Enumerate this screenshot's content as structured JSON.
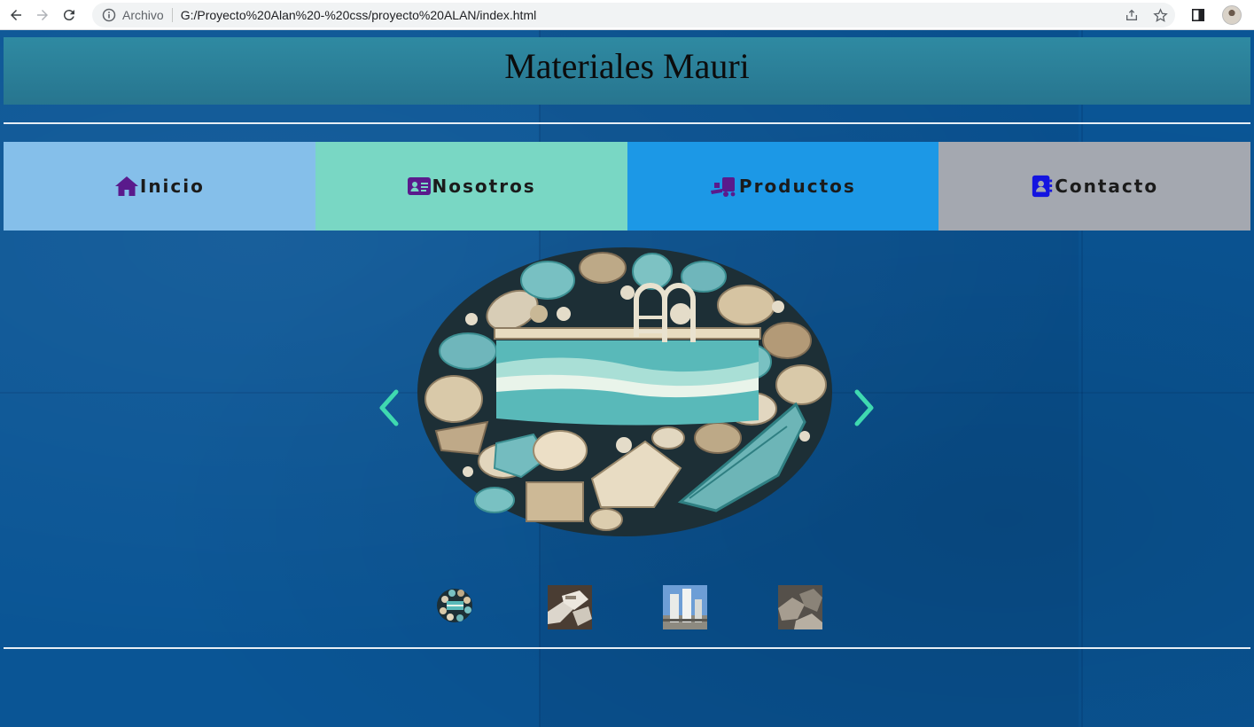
{
  "browser": {
    "protocol_label": "Archivo",
    "url": "G:/Proyecto%20Alan%20-%20css/proyecto%20ALAN/index.html",
    "icons": [
      "back-icon",
      "forward-icon",
      "reload-icon",
      "info-icon",
      "share-icon",
      "star-icon",
      "sidebar-icon",
      "profile-avatar"
    ]
  },
  "site": {
    "title": "Materiales Mauri"
  },
  "menu": {
    "items": [
      {
        "label": "Inicio",
        "icon": "home-icon",
        "bg": "#85bfea"
      },
      {
        "label": "Nosotros",
        "icon": "id-card-icon",
        "bg": "#79d7c4"
      },
      {
        "label": "Productos",
        "icon": "truck-ramp-icon",
        "bg": "#1c98e6"
      },
      {
        "label": "Contacto",
        "icon": "contact-book-icon",
        "bg": "#a4a8b0"
      }
    ]
  },
  "carousel": {
    "slide_icon": "pool-stones-logo",
    "prev_icon": "chevron-left-icon",
    "next_icon": "chevron-right-icon",
    "arrow_color": "#3fd9b0",
    "thumbnails": [
      {
        "icon": "logo-thumbnail"
      },
      {
        "icon": "cement-bags-thumbnail"
      },
      {
        "icon": "silos-thumbnail"
      },
      {
        "icon": "stone-pile-thumbnail"
      }
    ]
  },
  "colors": {
    "header": "#2f8aa2",
    "page_background": "#0a5595",
    "menu_icon": "#5a1a8c",
    "contact_icon": "#1414e0"
  }
}
